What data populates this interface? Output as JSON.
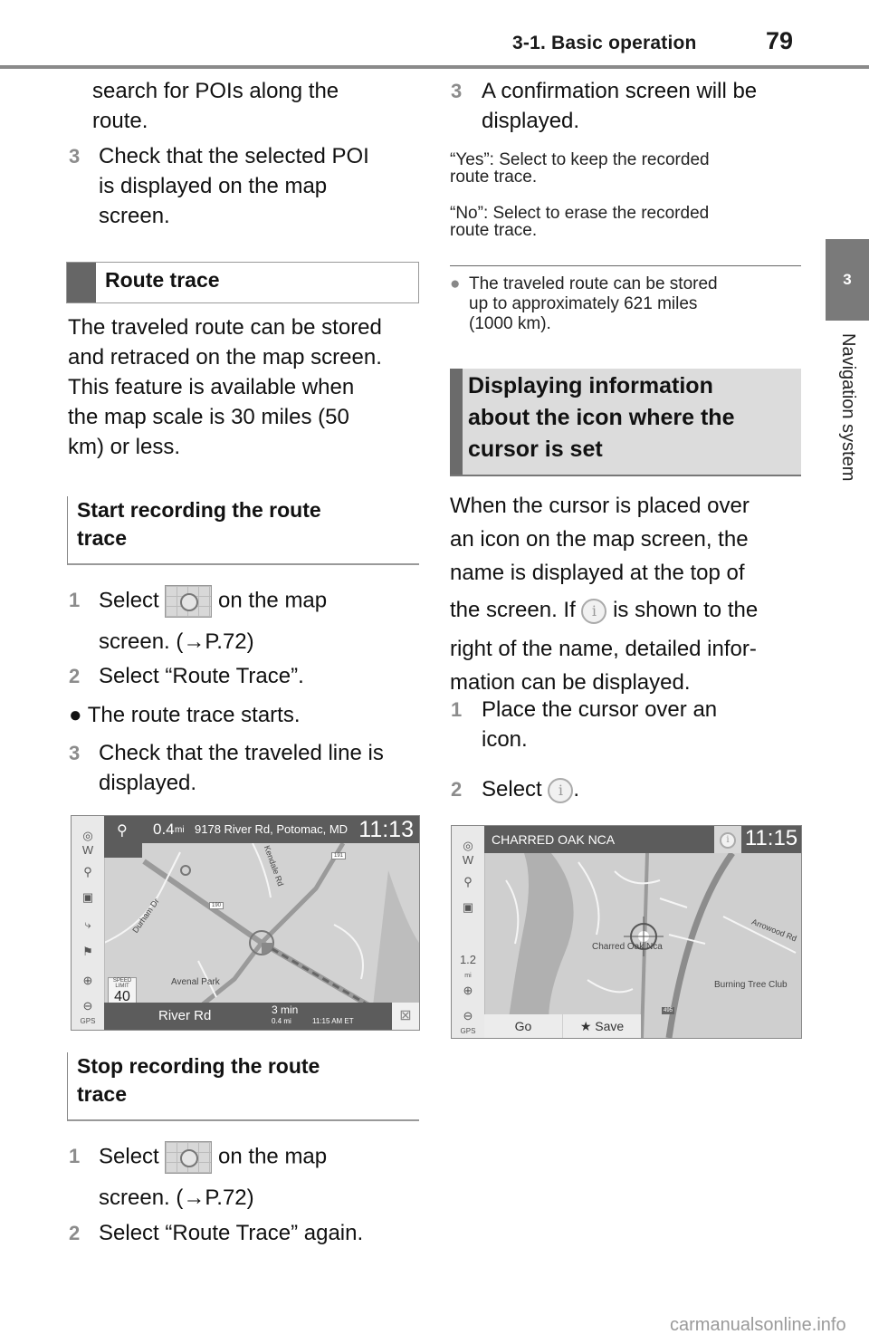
{
  "header": {
    "section": "3-1. Basic operation",
    "page_number": "79"
  },
  "side_tab": {
    "chapter_number": "3",
    "chapter_label": "Navigation system"
  },
  "left_column": {
    "continuation_lines": [
      "search for POIs along the",
      "route."
    ],
    "step3_prev": {
      "num": "3",
      "lines": [
        "Check that the selected POI",
        "is displayed on the map",
        "screen."
      ]
    },
    "route_trace_heading": "Route trace",
    "intro_lines": [
      "The traveled route can be stored",
      "and retraced on the map screen.",
      "This feature is available when",
      "the map scale is 30 miles (50",
      "km) or less."
    ],
    "start_heading_lines": [
      "Start recording the route",
      "trace"
    ],
    "start_steps": [
      {
        "num": "1",
        "before": "Select",
        "after": "on the map",
        "line2": "screen. (→P.72)"
      },
      {
        "num": "2",
        "text": "Select “Route Trace”."
      },
      {
        "bullet": "●",
        "text": "The route trace starts."
      },
      {
        "num": "3",
        "lines": [
          "Check that the traveled line is",
          "displayed."
        ]
      }
    ],
    "stop_heading_lines": [
      "Stop recording the route",
      "trace"
    ],
    "stop_steps": [
      {
        "num": "1",
        "before": "Select",
        "after": "on the map",
        "line2": "screen. (→P.72)"
      },
      {
        "num": "2",
        "text": "Select “Route Trace” again."
      }
    ],
    "screen1": {
      "distance": "0.4",
      "distance_unit": "mi",
      "address": "9178 River Rd, Potomac, MD",
      "clock": "11:13",
      "compass": "W",
      "speed_limit_label": "SPEED LIMIT",
      "speed_limit": "40",
      "road_name": "River Rd",
      "eta_time": "3 min",
      "eta_distance": "0.4 mi",
      "arrival": "11:15 AM ET",
      "map_labels": [
        "Durham Dr",
        "Kendale Rd",
        "Avenal Park",
        "190",
        "191"
      ],
      "gps": "GPS"
    }
  },
  "right_column": {
    "step3": {
      "num": "3",
      "lines": [
        "A confirmation screen will be",
        "displayed."
      ]
    },
    "yes_note": [
      "“Yes”: Select to keep the recorded",
      "route trace."
    ],
    "no_note": [
      "“No”: Select to erase the recorded",
      "route trace."
    ],
    "bullet_note": {
      "bullet": "●",
      "lines": [
        "The traveled route can be stored",
        "up to approximately 621 miles",
        "(1000 km)."
      ]
    },
    "info_heading_lines": [
      "Displaying information",
      "about the icon where the",
      "cursor is set"
    ],
    "para_lines": [
      "When the cursor is placed over",
      "an icon on the map screen, the",
      "name is displayed at the top of"
    ],
    "para_line4_before": "the screen. If",
    "para_line4_after": "is shown to the",
    "para_lines_end": [
      "right of the name, detailed infor-",
      "mation can be displayed."
    ],
    "steps": [
      {
        "num": "1",
        "lines": [
          "Place the cursor over an",
          "icon."
        ]
      },
      {
        "num": "2",
        "before": "Select",
        "after": "."
      }
    ],
    "screen2": {
      "poi_name": "CHARRED OAK NCA",
      "clock": "11:15",
      "compass": "W",
      "scale": "1.2",
      "scale_unit": "mi",
      "go_label": "Go",
      "save_label": "★ Save",
      "map_labels": [
        "Charred Oak Nca",
        "Arrowood Rd",
        "Burning Tree Club",
        "495"
      ],
      "gps": "GPS"
    }
  },
  "watermark": "carmanualsonline.info"
}
